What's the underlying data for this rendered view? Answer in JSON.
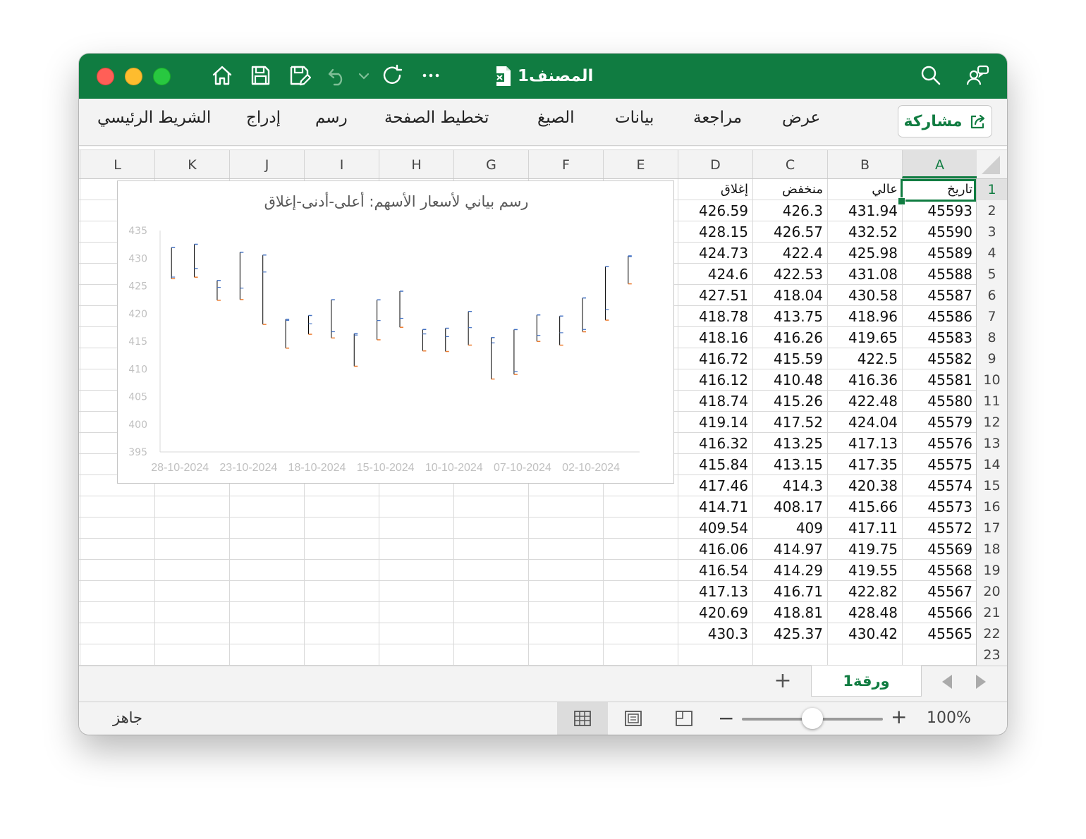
{
  "titlebar": {
    "doc_title": "المصنف1",
    "icons": [
      "home-icon",
      "save-icon",
      "save-as-icon",
      "undo-icon",
      "chevron-down-icon",
      "redo-icon",
      "more-icon",
      "search-icon",
      "account-icon"
    ]
  },
  "ribbon": {
    "tabs": [
      "الشريط الرئيسي",
      "إدراج",
      "رسم",
      "تخطيط الصفحة",
      "الصيغ",
      "بيانات",
      "مراجعة",
      "عرض"
    ],
    "share_label": "مشاركة"
  },
  "grid": {
    "columns": [
      "A",
      "B",
      "C",
      "D",
      "E",
      "F",
      "G",
      "H",
      "I",
      "J",
      "K",
      "L"
    ],
    "headers": [
      "تاريخ",
      "عالي",
      "منخفض",
      "إغلاق"
    ],
    "rows": [
      [
        "45593",
        "431.94",
        "426.3",
        "426.59"
      ],
      [
        "45590",
        "432.52",
        "426.57",
        "428.15"
      ],
      [
        "45589",
        "425.98",
        "422.4",
        "424.73"
      ],
      [
        "45588",
        "431.08",
        "422.53",
        "424.6"
      ],
      [
        "45587",
        "430.58",
        "418.04",
        "427.51"
      ],
      [
        "45586",
        "418.96",
        "413.75",
        "418.78"
      ],
      [
        "45583",
        "419.65",
        "416.26",
        "418.16"
      ],
      [
        "45582",
        "422.5",
        "415.59",
        "416.72"
      ],
      [
        "45581",
        "416.36",
        "410.48",
        "416.12"
      ],
      [
        "45580",
        "422.48",
        "415.26",
        "418.74"
      ],
      [
        "45579",
        "424.04",
        "417.52",
        "419.14"
      ],
      [
        "45576",
        "417.13",
        "413.25",
        "416.32"
      ],
      [
        "45575",
        "417.35",
        "413.15",
        "415.84"
      ],
      [
        "45574",
        "420.38",
        "414.3",
        "417.46"
      ],
      [
        "45573",
        "415.66",
        "408.17",
        "414.71"
      ],
      [
        "45572",
        "417.11",
        "409",
        "409.54"
      ],
      [
        "45569",
        "419.75",
        "414.97",
        "416.06"
      ],
      [
        "45568",
        "419.55",
        "414.29",
        "416.54"
      ],
      [
        "45567",
        "422.82",
        "416.71",
        "417.13"
      ],
      [
        "45566",
        "428.48",
        "418.81",
        "420.69"
      ],
      [
        "45565",
        "430.42",
        "425.37",
        "430.3"
      ]
    ],
    "row_numbers": [
      "1",
      "2",
      "3",
      "4",
      "5",
      "6",
      "7",
      "8",
      "9",
      "10",
      "11",
      "12",
      "13",
      "14",
      "15",
      "16",
      "17",
      "18",
      "19",
      "20",
      "21",
      "22",
      "23"
    ]
  },
  "chart_data": {
    "type": "stock-hlc",
    "title": "رسم بياني لأسعار الأسهم: أعلى-أدنى-إغلاق",
    "ylim": [
      395,
      435
    ],
    "yticks": [
      "395",
      "400",
      "405",
      "410",
      "415",
      "420",
      "425",
      "430",
      "435"
    ],
    "xtick_labels": [
      "28-10-2024",
      "23-10-2024",
      "18-10-2024",
      "15-10-2024",
      "10-10-2024",
      "07-10-2024",
      "02-10-2024"
    ],
    "x_direction": "reversed",
    "categories": [
      "28-10-2024",
      "25-10-2024",
      "24-10-2024",
      "23-10-2024",
      "22-10-2024",
      "21-10-2024",
      "18-10-2024",
      "17-10-2024",
      "16-10-2024",
      "15-10-2024",
      "14-10-2024",
      "11-10-2024",
      "10-10-2024",
      "09-10-2024",
      "08-10-2024",
      "07-10-2024",
      "04-10-2024",
      "03-10-2024",
      "02-10-2024",
      "01-10-2024",
      "30-09-2024"
    ],
    "high": [
      431.94,
      432.52,
      425.98,
      431.08,
      430.58,
      418.96,
      419.65,
      422.5,
      416.36,
      422.48,
      424.04,
      417.13,
      417.35,
      420.38,
      415.66,
      417.11,
      419.75,
      419.55,
      422.82,
      428.48,
      430.42
    ],
    "low": [
      426.3,
      426.57,
      422.4,
      422.53,
      418.04,
      413.75,
      416.26,
      415.59,
      410.48,
      415.26,
      417.52,
      413.25,
      413.15,
      414.3,
      408.17,
      409,
      414.97,
      414.29,
      416.71,
      418.81,
      425.37
    ],
    "close": [
      426.59,
      428.15,
      424.73,
      424.6,
      427.51,
      418.78,
      418.16,
      416.72,
      416.12,
      418.74,
      419.14,
      416.32,
      415.84,
      417.46,
      414.71,
      409.54,
      416.06,
      416.54,
      417.13,
      420.69,
      430.3
    ],
    "colors": {
      "range_line": "#000000",
      "high_tick": "#4472c4",
      "close_tick": "#ed7d31",
      "axis_text": "#c0c0c0"
    }
  },
  "sheets": {
    "tabs": [
      "ورقة1"
    ],
    "add_label": "+"
  },
  "status": {
    "text": "جاهز",
    "zoom": "100%",
    "zoom_fraction": 0.5
  },
  "colors": {
    "accent": "#107c41"
  }
}
